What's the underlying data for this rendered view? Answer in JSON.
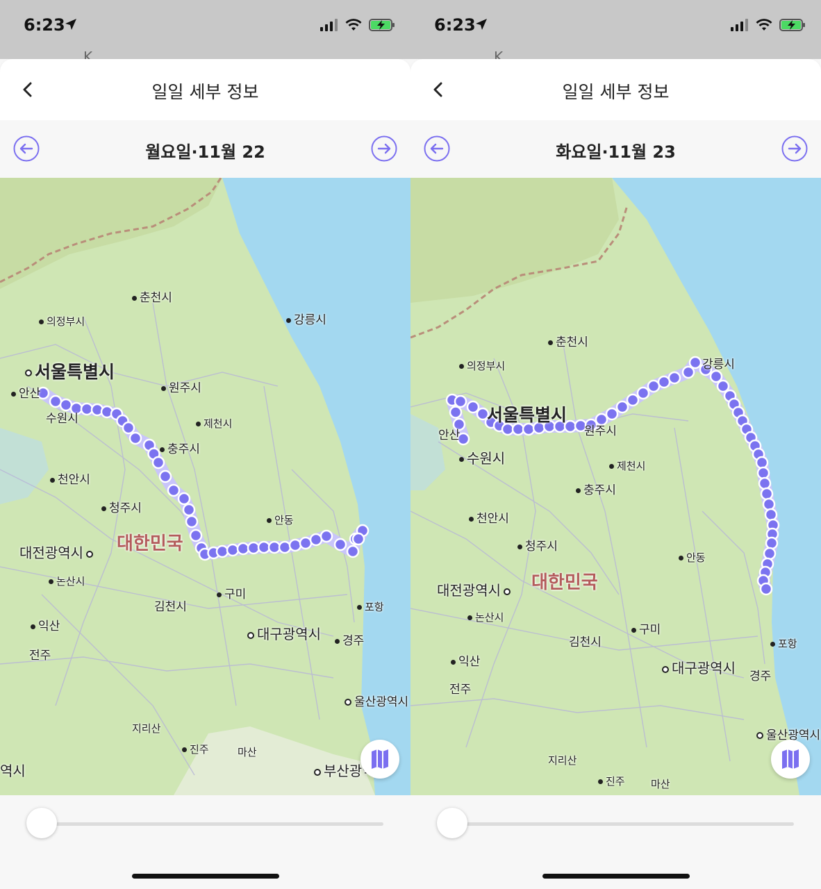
{
  "status_bar": {
    "time": "6:23"
  },
  "header": {
    "title": "일일 세부 정보",
    "peek_text": "K..."
  },
  "colors": {
    "accent": "#7b6ff0",
    "route_fill": "#7b73f0",
    "route_halo": "#c9c5fa",
    "sea": "#a3d8f0",
    "land": "#cfe6b4"
  },
  "screens": [
    {
      "date_label": "월요일·11월 22",
      "slider_progress": 0,
      "map_labels": {
        "chuncheon": "춘천시",
        "gangneung": "강릉시",
        "uijeongbu": "의정부시",
        "seoul": "서울특별시",
        "wonju": "원주시",
        "ansan": "안산",
        "suwon": "수원시",
        "jecheon": "제천시",
        "chungju": "충주시",
        "cheonan": "천안시",
        "cheongju": "청주시",
        "andong": "안동",
        "daejeon": "대전광역시",
        "korea": "대한민국",
        "nonsan": "논산시",
        "gumi": "구미",
        "gimcheon": "김천시",
        "pohang": "포항",
        "iksan": "익산",
        "daegu": "대구광역시",
        "gyeongju": "경주",
        "jeonju": "전주",
        "ulsan": "울산광역시",
        "jirisan": "지리산",
        "jinju": "진주",
        "masan": "마산",
        "busan": "부산광역시",
        "edge": "역시"
      }
    },
    {
      "date_label": "화요일·11월 23",
      "slider_progress": 0,
      "map_labels": {
        "chuncheon": "춘천시",
        "gangneung": "강릉시",
        "uijeongbu": "의정부시",
        "seoul": "서울특별시",
        "wonju": "원주시",
        "ansan": "안산",
        "suwon": "수원시",
        "jecheon": "제천시",
        "chungju": "충주시",
        "cheonan": "천안시",
        "cheongju": "청주시",
        "andong": "안동",
        "daejeon": "대전광역시",
        "korea": "대한민국",
        "nonsan": "논산시",
        "gumi": "구미",
        "gimcheon": "김천시",
        "pohang": "포항",
        "iksan": "익산",
        "daegu": "대구광역시",
        "gyeongju": "경주",
        "jeonju": "전주",
        "ulsan": "울산광역시",
        "jirisan": "지리산",
        "jinju": "진주",
        "masan": "마산"
      }
    }
  ],
  "icons": {
    "back": "chevron-left-icon",
    "prev": "arrow-left-circle-icon",
    "next": "arrow-right-circle-icon",
    "map": "map-icon"
  }
}
